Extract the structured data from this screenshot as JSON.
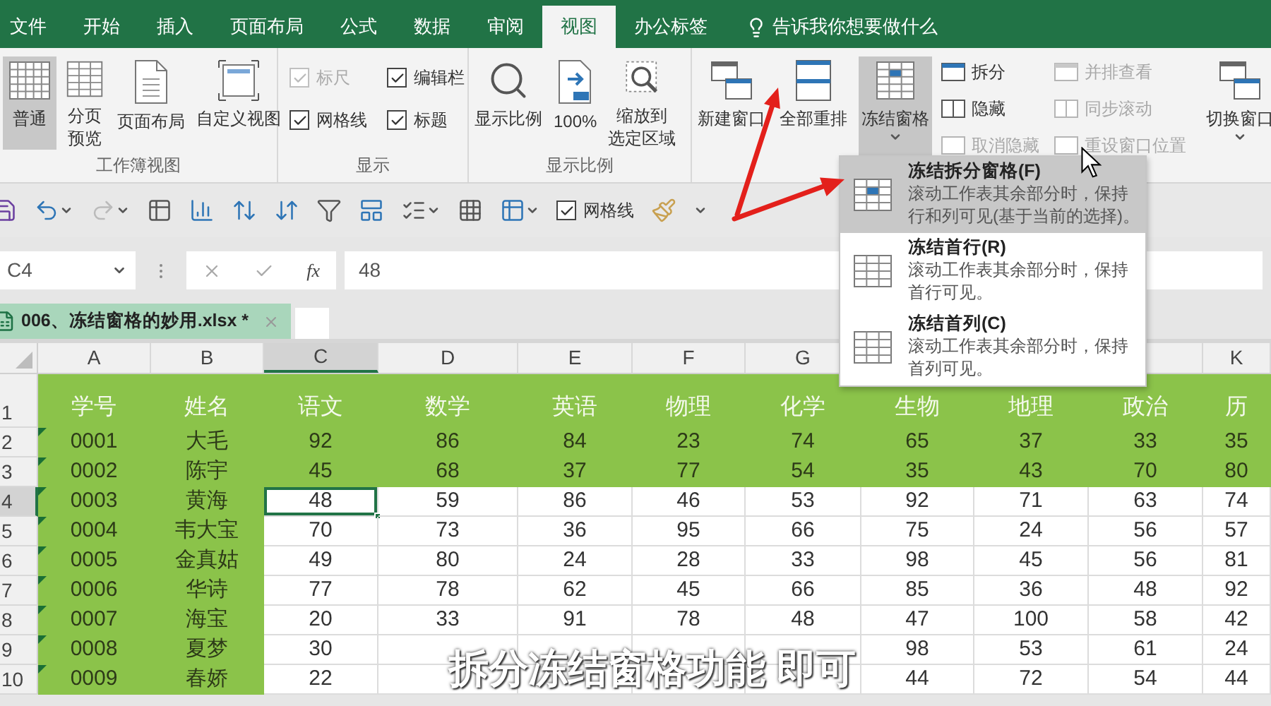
{
  "ribbon_tabs": [
    {
      "label": "文件",
      "selected": false
    },
    {
      "label": "开始",
      "selected": false
    },
    {
      "label": "插入",
      "selected": false
    },
    {
      "label": "页面布局",
      "selected": false
    },
    {
      "label": "公式",
      "selected": false
    },
    {
      "label": "数据",
      "selected": false
    },
    {
      "label": "审阅",
      "selected": false
    },
    {
      "label": "视图",
      "selected": true
    },
    {
      "label": "办公标签",
      "selected": false
    }
  ],
  "tell_me": "告诉我你想要做什么",
  "ribbon": {
    "workbook_views": {
      "label": "工作簿视图",
      "buttons": [
        {
          "lines": [
            "普通"
          ],
          "selected": true
        },
        {
          "lines": [
            "分页",
            "预览"
          ],
          "selected": false
        },
        {
          "lines": [
            "页面布局"
          ],
          "selected": false
        },
        {
          "lines": [
            "自定义视图"
          ],
          "selected": false
        }
      ]
    },
    "show": {
      "label": "显示",
      "checkboxes": [
        {
          "label": "标尺",
          "checked": true,
          "disabled": true
        },
        {
          "label": "编辑栏",
          "checked": true,
          "disabled": false
        },
        {
          "label": "网格线",
          "checked": true,
          "disabled": false
        },
        {
          "label": "标题",
          "checked": true,
          "disabled": false
        }
      ]
    },
    "zoom": {
      "label": "显示比例",
      "buttons": [
        {
          "lines": [
            "显示比例"
          ]
        },
        {
          "lines": [
            "100%"
          ]
        },
        {
          "lines": [
            "缩放到",
            "选定区域"
          ]
        }
      ]
    },
    "window": {
      "large_buttons": [
        {
          "lines": [
            "新建窗口"
          ],
          "kind": "button",
          "expanded": false
        },
        {
          "lines": [
            "全部重排"
          ],
          "kind": "button",
          "expanded": false
        },
        {
          "lines": [
            "冻结窗格"
          ],
          "kind": "dropdown",
          "expanded": true
        }
      ],
      "small_buttons": [
        {
          "label": "拆分",
          "disabled": false
        },
        {
          "label": "隐藏",
          "disabled": false
        },
        {
          "label": "取消隐藏",
          "disabled": true
        },
        {
          "label": "并排查看",
          "disabled": true
        },
        {
          "label": "同步滚动",
          "disabled": true
        },
        {
          "label": "重设窗口位置",
          "disabled": true
        }
      ],
      "switch_windows": {
        "lines": [
          "切换窗口"
        ],
        "expanded": false
      }
    }
  },
  "quick_access": {
    "gridlines": {
      "label": "网格线",
      "checked": true
    }
  },
  "formula_bar": {
    "name_box": "C4",
    "function_label": "fx",
    "value": "48"
  },
  "document_tabs": [
    {
      "title": "006、冻结窗格的妙用.xlsx *",
      "selected": true
    }
  ],
  "freeze_menu": {
    "items": [
      {
        "title": "冻结拆分窗格(F)",
        "description_lines": [
          "滚动工作表其余部分时，保持",
          "行和列可见(基于当前的选择)。"
        ],
        "selected": true
      },
      {
        "title": "冻结首行(R)",
        "description_lines": [
          "滚动工作表其余部分时，保持",
          "首行可见。"
        ],
        "selected": false
      },
      {
        "title": "冻结首列(C)",
        "description_lines": [
          "滚动工作表其余部分时，保持",
          "首列可见。"
        ],
        "selected": false
      }
    ]
  },
  "sheet": {
    "columns": [
      {
        "letter": "A",
        "selected": false,
        "highlighted": true,
        "flags": true
      },
      {
        "letter": "B",
        "selected": false,
        "highlighted": true,
        "flags": false
      },
      {
        "letter": "C",
        "selected": true,
        "highlighted": false,
        "flags": false
      },
      {
        "letter": "D",
        "selected": false,
        "highlighted": false,
        "flags": false
      },
      {
        "letter": "E",
        "selected": false,
        "highlighted": false,
        "flags": false
      },
      {
        "letter": "F",
        "selected": false,
        "highlighted": false,
        "flags": false
      },
      {
        "letter": "G",
        "selected": false,
        "highlighted": false,
        "flags": false
      },
      {
        "selected": false,
        "highlighted": false,
        "flags": false
      },
      {
        "selected": false,
        "highlighted": false,
        "flags": false
      },
      {
        "selected": false,
        "highlighted": false,
        "flags": false
      },
      {
        "letter": "K",
        "selected": false,
        "highlighted": false,
        "flags": false
      }
    ],
    "rows": [
      {
        "number": "1",
        "kind": "header",
        "highlighted": true,
        "selected": false,
        "cells": [
          "学号",
          "姓名",
          "语文",
          "数学",
          "英语",
          "物理",
          "化学",
          "生物",
          "地理",
          "政治",
          "历"
        ]
      },
      {
        "number": "2",
        "kind": "data",
        "highlighted": true,
        "selected": false,
        "cells": [
          "0001",
          "大毛",
          "92",
          "86",
          "84",
          "23",
          "74",
          "65",
          "37",
          "33",
          "35"
        ]
      },
      {
        "number": "3",
        "kind": "data",
        "highlighted": true,
        "selected": false,
        "cells": [
          "0002",
          "陈宇",
          "45",
          "68",
          "37",
          "77",
          "54",
          "35",
          "43",
          "70",
          "80"
        ]
      },
      {
        "number": "4",
        "kind": "data",
        "highlighted": false,
        "selected": true,
        "cells": [
          "0003",
          "黄海",
          "48",
          "59",
          "86",
          "46",
          "53",
          "92",
          "71",
          "63",
          "74"
        ]
      },
      {
        "number": "5",
        "kind": "data",
        "highlighted": false,
        "selected": false,
        "cells": [
          "0004",
          "韦大宝",
          "70",
          "73",
          "36",
          "95",
          "66",
          "75",
          "24",
          "56",
          "57"
        ]
      },
      {
        "number": "6",
        "kind": "data",
        "highlighted": false,
        "selected": false,
        "cells": [
          "0005",
          "金真姑",
          "49",
          "80",
          "24",
          "28",
          "33",
          "98",
          "45",
          "56",
          "81"
        ]
      },
      {
        "number": "7",
        "kind": "data",
        "highlighted": false,
        "selected": false,
        "cells": [
          "0006",
          "华诗",
          "77",
          "78",
          "62",
          "45",
          "66",
          "85",
          "36",
          "48",
          "92"
        ]
      },
      {
        "number": "8",
        "kind": "data",
        "highlighted": false,
        "selected": false,
        "cells": [
          "0007",
          "海宝",
          "20",
          "33",
          "91",
          "78",
          "48",
          "47",
          "100",
          "58",
          "42"
        ]
      },
      {
        "number": "9",
        "kind": "data",
        "highlighted": false,
        "selected": false,
        "cells": [
          "0008",
          "夏梦",
          "30",
          null,
          null,
          null,
          null,
          "98",
          "53",
          "61",
          "24"
        ]
      },
      {
        "number": "10",
        "kind": "data",
        "highlighted": false,
        "selected": false,
        "cells": [
          "0009",
          "春娇",
          "22",
          null,
          null,
          null,
          null,
          "44",
          "72",
          "54",
          "44"
        ]
      }
    ]
  },
  "caption": "拆分冻结窗格功能 即可"
}
